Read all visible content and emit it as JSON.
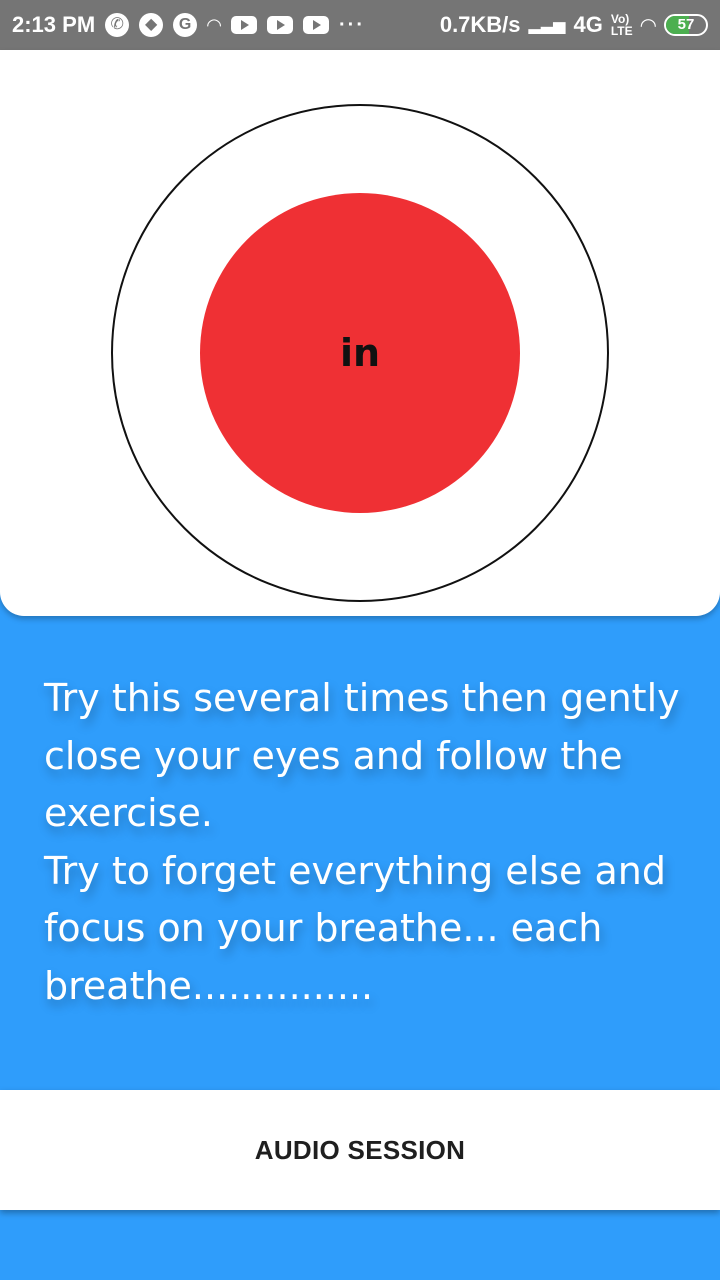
{
  "status_bar": {
    "time": "2:13 PM",
    "left_icons": [
      "whatsapp-icon",
      "app-icon",
      "google-icon",
      "wifi-calling-icon",
      "youtube-icon",
      "youtube-icon",
      "youtube-icon"
    ],
    "overflow": "···",
    "network_speed": "0.7KB/s",
    "network_type": "4G",
    "volte_top": "Vo)",
    "volte_bottom": "LTE",
    "battery_level": 57,
    "battery_label": "57"
  },
  "breathing": {
    "phase_label": "in",
    "circle_color": "#EF3034",
    "ring_color": "#111111"
  },
  "instructions": {
    "lines": [
      "Try this several times then gently close your eyes and follow the exercise.",
      "Try to forget everything else and focus on your breathe... each breathe..............."
    ]
  },
  "audio_session": {
    "label": "AUDIO SESSION"
  },
  "colors": {
    "background": "#2F9DFB",
    "status_bar": "#757575",
    "card": "#ffffff"
  }
}
